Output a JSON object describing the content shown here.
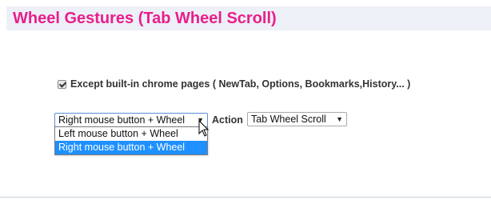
{
  "header": {
    "title": "Wheel Gestures (Tab Wheel Scroll)"
  },
  "options": {
    "except_builtin_label": "Except built-in chrome pages ( NewTab, Options, Bookmarks,History... )",
    "except_builtin_checked": true
  },
  "gesture_select": {
    "value": "Right mouse button + Wheel",
    "options": [
      "Left mouse button + Wheel",
      "Right mouse button + Wheel"
    ],
    "highlighted": "Right mouse button + Wheel",
    "arrow_icon": "triangle-down-icon"
  },
  "action": {
    "label": "Action",
    "value": "Tab Wheel Scroll",
    "arrow_icon": "triangle-down-icon"
  },
  "colors": {
    "title": "#e91e8c",
    "header_bg": "#eef0f7",
    "option_highlight": "#1e90ff"
  }
}
